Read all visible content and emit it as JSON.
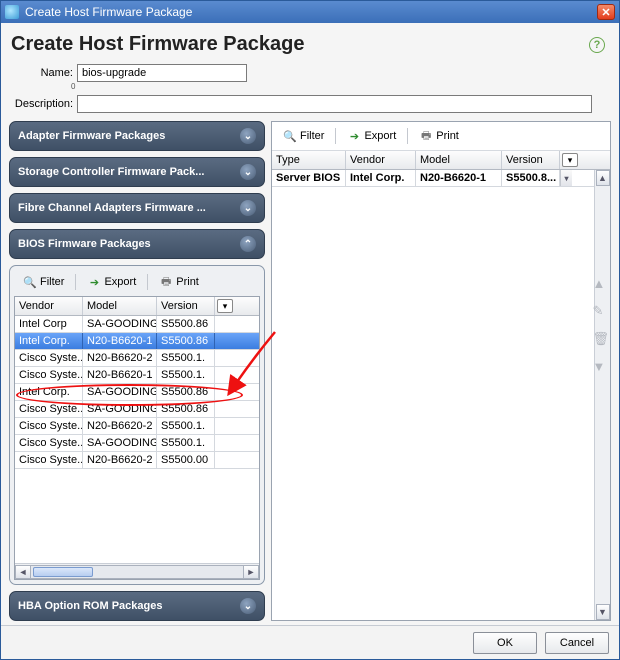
{
  "window": {
    "title": "Create Host Firmware Package"
  },
  "header": {
    "heading": "Create Host Firmware Package"
  },
  "form": {
    "name_label": "Name:",
    "name_value": "bios-upgrade",
    "zero_marker": "0",
    "desc_label": "Description:",
    "desc_value": ""
  },
  "toolbar": {
    "filter_label": "Filter",
    "export_label": "Export",
    "print_label": "Print"
  },
  "accordions": {
    "adapter": "Adapter Firmware Packages",
    "storage": "Storage Controller Firmware Pack...",
    "fibre": "Fibre Channel Adapters Firmware ...",
    "bios": "BIOS Firmware Packages",
    "hba": "HBA Option ROM Packages"
  },
  "left_table": {
    "headers": {
      "vendor": "Vendor",
      "model": "Model",
      "version": "Version"
    },
    "rows": [
      {
        "vendor": "Intel Corp",
        "model": "SA-GOODING",
        "version": "S5500.86"
      },
      {
        "vendor": "Intel Corp.",
        "model": "N20-B6620-1",
        "version": "S5500.86",
        "selected": true
      },
      {
        "vendor": "Cisco Syste...",
        "model": "N20-B6620-2",
        "version": "S5500.1."
      },
      {
        "vendor": "Cisco Syste...",
        "model": "N20-B6620-1",
        "version": "S5500.1."
      },
      {
        "vendor": "Intel Corp.",
        "model": "SA-GOODING",
        "version": "S5500.86"
      },
      {
        "vendor": "Cisco Syste...",
        "model": "SA-GOODING",
        "version": "S5500.86"
      },
      {
        "vendor": "Cisco Syste...",
        "model": "N20-B6620-2",
        "version": "S5500.1."
      },
      {
        "vendor": "Cisco Syste...",
        "model": "SA-GOODING",
        "version": "S5500.1."
      },
      {
        "vendor": "Cisco Syste...",
        "model": "N20-B6620-2",
        "version": "S5500.00"
      }
    ]
  },
  "right_table": {
    "headers": {
      "type": "Type",
      "vendor": "Vendor",
      "model": "Model",
      "version": "Version"
    },
    "rows": [
      {
        "type": "Server BIOS",
        "vendor": "Intel Corp.",
        "model": "N20-B6620-1",
        "version": "S5500.8..."
      }
    ]
  },
  "footer": {
    "ok": "OK",
    "cancel": "Cancel"
  }
}
